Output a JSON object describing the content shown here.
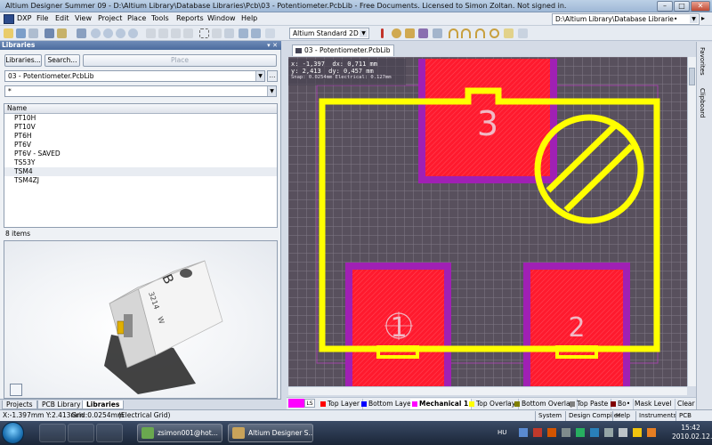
{
  "window": {
    "title": "Altium Designer Summer 09 - D:\\Altium Library\\Database Libraries\\Pcb\\03 - Potentiometer.PcbLib - Free Documents. Licensed to Simon Zoltan. Not signed in."
  },
  "menu": {
    "dxp": "DXP",
    "items": [
      "File",
      "Edit",
      "View",
      "Project",
      "Place",
      "Tools",
      "Reports",
      "Window",
      "Help"
    ],
    "path": "D:\\Altium Library\\Database Librarie•"
  },
  "toolbar": {
    "view_mode": "Altium Standard 2D"
  },
  "libraries_panel": {
    "title": "Libraries",
    "libraries_button": "Libraries...",
    "search_button": "Search...",
    "place_button": "Place",
    "library_select": "03 - Potentiometer.PcbLib",
    "filter_value": "*",
    "column_header": "Name",
    "items": [
      "PT10H",
      "PT10V",
      "PT6H",
      "PT6V",
      "PT6V - SAVED",
      "TS53Y",
      "TSM4",
      "TSM4ZJ"
    ],
    "selected_index": 6,
    "item_count": "8 items",
    "preview_labels": {
      "top_letter": "B",
      "part_number": "3214",
      "side": "W"
    }
  },
  "panel_tabs": [
    "Projects",
    "PCB Library",
    "Libraries"
  ],
  "active_panel_tab": "Libraries",
  "document": {
    "tab": "03 - Potentiometer.PcbLib",
    "coords": {
      "x": "x: -1,397",
      "dx": "dx:  0,711 mm",
      "y": "y:  2,413",
      "dy": "dy:  0,457 mm",
      "snap": "Snap: 0.0254mm Electrical: 0.127mm"
    },
    "pads": [
      "3",
      "1",
      "2"
    ]
  },
  "right_tabs": [
    "Favorites",
    "Clipboard"
  ],
  "layers": {
    "ls_label": "LS",
    "tabs": [
      {
        "label": "Top Layer",
        "color": "#ff0000"
      },
      {
        "label": "Bottom Layer",
        "color": "#0000ff"
      },
      {
        "label": "Mechanical 1",
        "color": "#ff00ff"
      },
      {
        "label": "Top Overlay",
        "color": "#ffff00"
      },
      {
        "label": "Bottom Overlay",
        "color": "#808000"
      },
      {
        "label": "Top Paste",
        "color": "#808080"
      },
      {
        "label": "Bo•",
        "color": "#800000"
      }
    ],
    "active": "Mechanical 1",
    "mask_level": "Mask Level",
    "clear": "Clear"
  },
  "status": {
    "position": "X:-1.397mm Y:2.413mm",
    "grid": "Grid:0.0254mm",
    "grid_type": "(Electrical Grid)",
    "buttons": [
      "System",
      "Design Compiler",
      "Help",
      "Instruments",
      "PCB"
    ]
  },
  "taskbar": {
    "tasks": [
      {
        "label": "zsimon001@hot..."
      },
      {
        "label": "Altium Designer S..."
      }
    ],
    "language": "HU",
    "time": "15:42",
    "date": "2010.02.12."
  },
  "colors": {
    "pad": "#ff1a2e",
    "solder_mask": "#a020b4",
    "overlay": "#ffff00",
    "board_bg": "#58505d"
  }
}
